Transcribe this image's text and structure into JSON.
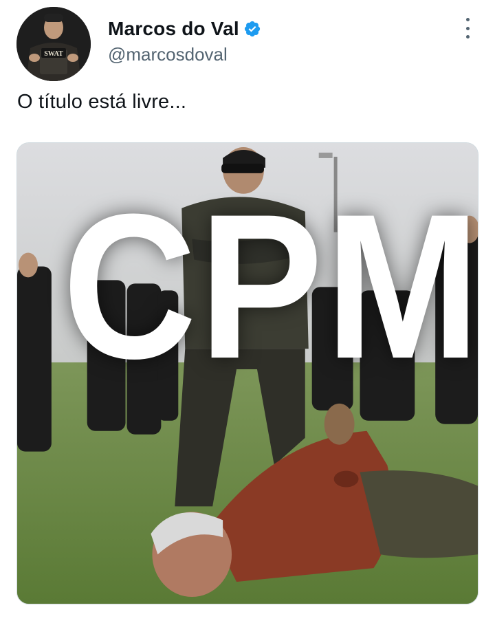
{
  "author": {
    "display_name": "Marcos do Val",
    "handle": "@marcosdoval",
    "avatar_badge_text": "SWAT",
    "verified": true
  },
  "tweet": {
    "text": "O título está livre..."
  },
  "media": {
    "overlay_text": "CPMI"
  },
  "icons": {
    "verified": "verified-badge-icon",
    "more": "more-options-icon"
  },
  "colors": {
    "verified_blue": "#1d9bf0",
    "secondary_text": "#536471",
    "primary_text": "#0f1419"
  }
}
